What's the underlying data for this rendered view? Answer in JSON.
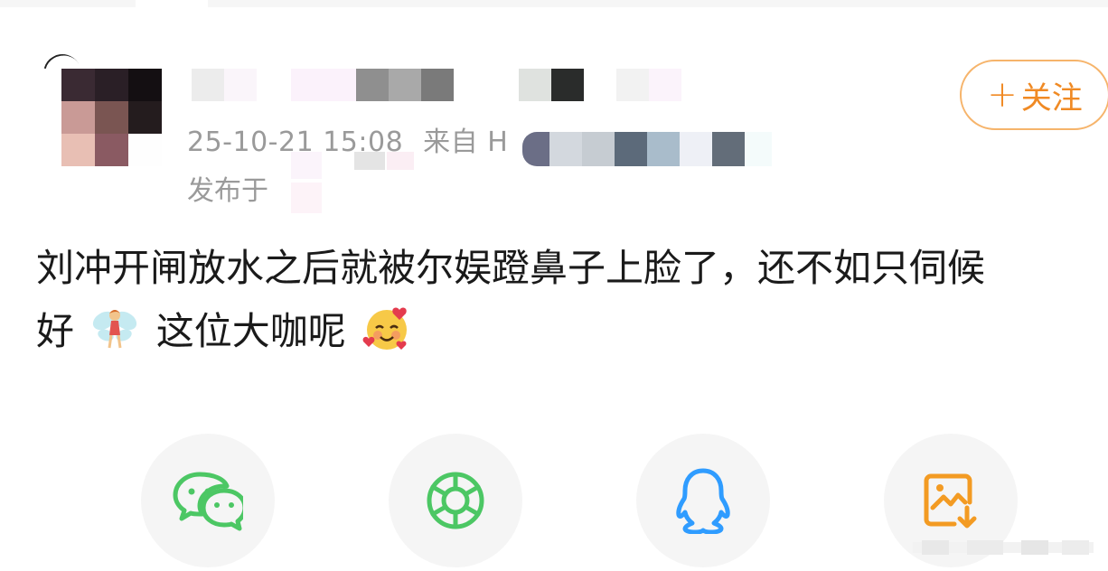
{
  "post": {
    "meta_time": "25-10-21 15:08",
    "meta_source_prefix": "来自 H",
    "published_prefix": "发布于",
    "text_line1": "刘冲开闸放水之后就被尔娱蹬鼻子上脸了，还不如只伺候",
    "text_line2_a": "好",
    "text_line2_b": "这位大咖呢",
    "emoji_1": "fairy",
    "emoji_2": "smiling-face-with-hearts"
  },
  "follow_button": {
    "label": "关注",
    "plus": "+",
    "color": "#f08a24"
  },
  "share_row": {
    "icons": [
      "wechat-icon",
      "moments-icon",
      "qq-icon",
      "save-image-icon"
    ],
    "colors": {
      "wechat": "#4cc764",
      "moments": "#4cc764",
      "qq": "#2f9cff",
      "save": "#f39b23"
    }
  }
}
